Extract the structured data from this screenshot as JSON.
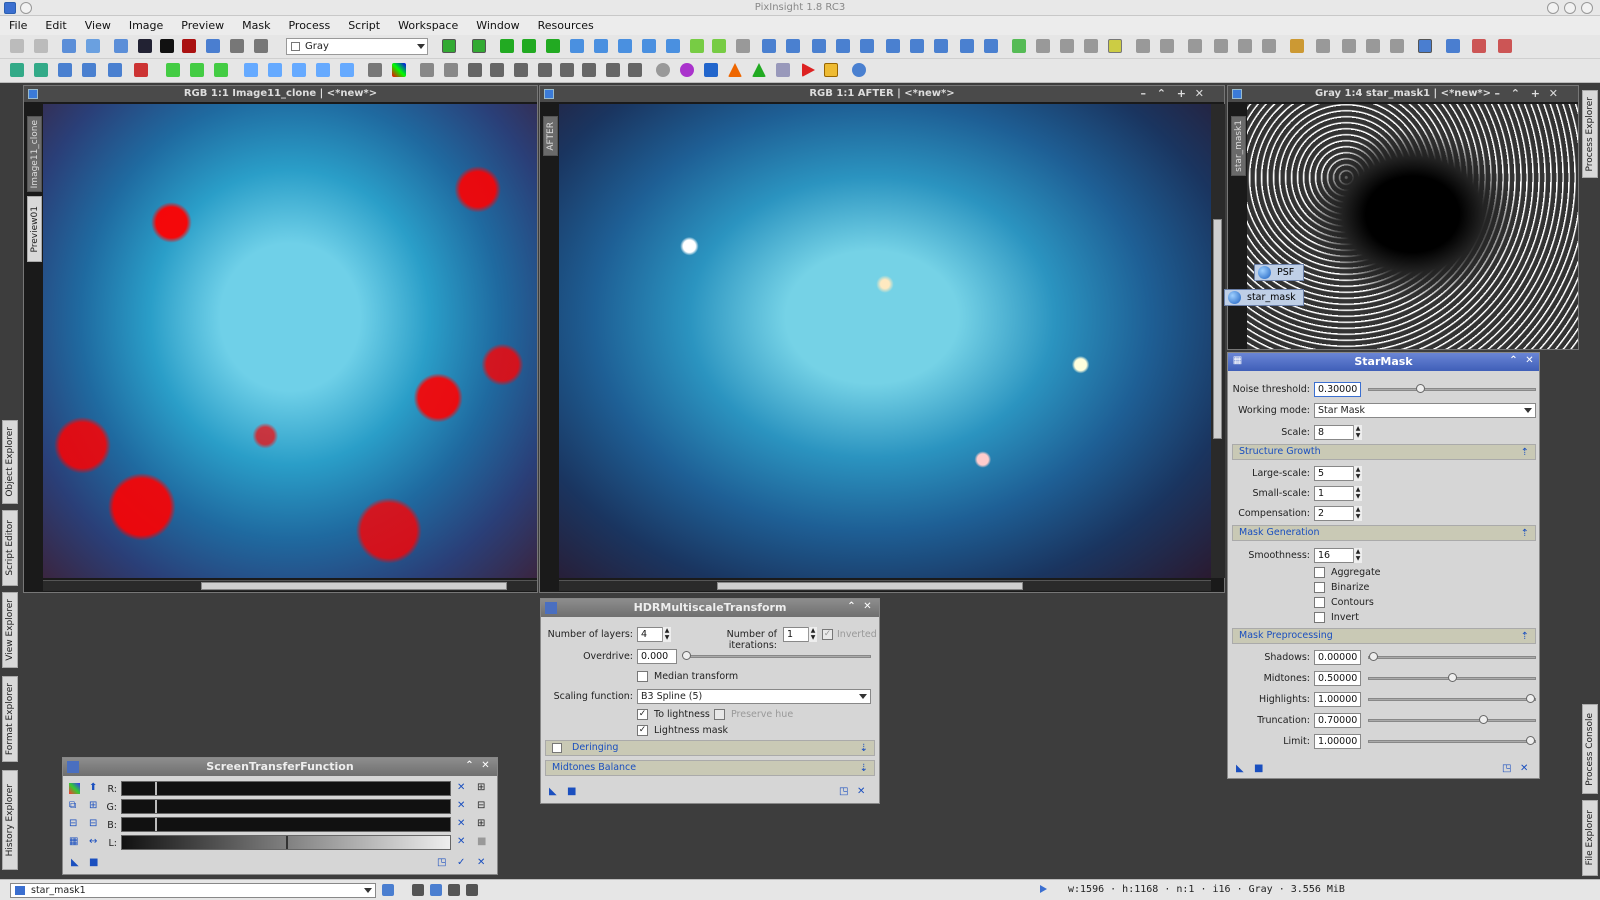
{
  "app": {
    "title": "PixInsight 1.8 RC3"
  },
  "menu": [
    "File",
    "Edit",
    "View",
    "Image",
    "Preview",
    "Mask",
    "Process",
    "Script",
    "Workspace",
    "Window",
    "Resources"
  ],
  "toolbar": {
    "color_space_value": "Gray"
  },
  "side_tabs_left": {
    "object_explorer": "Object Explorer",
    "script_editor": "Script Editor",
    "view_explorer": "View Explorer",
    "format_explorer": "Format Explorer",
    "history_explorer": "History Explorer"
  },
  "side_tabs_right": {
    "process_explorer": "Process Explorer",
    "process_console": "Process Console",
    "file_explorer": "File Explorer"
  },
  "windows": {
    "clone": {
      "title": "RGB 1:1 Image11_clone | <*new*>",
      "tab1": "Image11_clone",
      "tab2": "Preview01"
    },
    "after": {
      "title": "RGB 1:1 AFTER | <*new*>",
      "tab1": "AFTER"
    },
    "mask": {
      "title": "Gray 1:4 star_mask1 | <*new*>",
      "tab1": "star_mask1"
    }
  },
  "floating_icons": {
    "psf": "PSF",
    "star_mask": "star_mask"
  },
  "starmask": {
    "title": "StarMask",
    "noise_threshold_label": "Noise threshold:",
    "noise_threshold": "0.30000",
    "noise_threshold_level": 0.3,
    "working_mode_label": "Working mode:",
    "working_mode": "Star Mask",
    "scale_label": "Scale:",
    "scale": "8",
    "structure_growth": "Structure Growth",
    "large_scale_label": "Large-scale:",
    "large_scale": "5",
    "small_scale_label": "Small-scale:",
    "small_scale": "1",
    "compensation_label": "Compensation:",
    "compensation": "2",
    "mask_generation": "Mask Generation",
    "smoothness_label": "Smoothness:",
    "smoothness": "16",
    "aggregate": "Aggregate",
    "binarize": "Binarize",
    "contours": "Contours",
    "invert": "Invert",
    "mask_preprocessing": "Mask Preprocessing",
    "shadows_label": "Shadows:",
    "shadows": "0.00000",
    "shadows_level": 0.0,
    "midtones_label": "Midtones:",
    "midtones": "0.50000",
    "midtones_level": 0.5,
    "highlights_label": "Highlights:",
    "highlights": "1.00000",
    "highlights_level": 1.0,
    "truncation_label": "Truncation:",
    "truncation": "0.70000",
    "truncation_level": 0.7,
    "limit_label": "Limit:",
    "limit": "1.00000",
    "limit_level": 1.0
  },
  "hdr": {
    "title": "HDRMultiscaleTransform",
    "layers_label": "Number of layers:",
    "layers": "4",
    "iterations_label": "Number of iterations:",
    "iterations": "1",
    "inverted": "Inverted",
    "overdrive_label": "Overdrive:",
    "overdrive": "0.000",
    "median_transform": "Median transform",
    "scaling_label": "Scaling function:",
    "scaling": "B3 Spline (5)",
    "to_lightness": "To lightness",
    "preserve_hue": "Preserve hue",
    "lightness_mask": "Lightness mask",
    "deringing": "Deringing",
    "midtones_balance": "Midtones Balance"
  },
  "stf": {
    "title": "ScreenTransferFunction",
    "r": "R:",
    "g": "G:",
    "b": "B:",
    "l": "L:"
  },
  "status": {
    "view": "star_mask1",
    "info": "w:1596 · h:1168 · n:1 · i16 · Gray · 3.556 MiB"
  }
}
